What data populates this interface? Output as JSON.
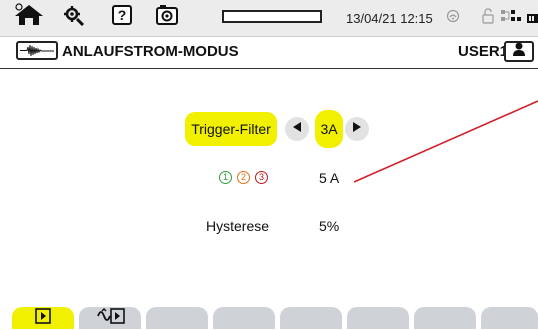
{
  "status_bar": {
    "datetime": "13/04/21 12:15",
    "icons": [
      "home-icon",
      "tools-icon",
      "help-icon",
      "camera-icon",
      "wifi-icon",
      "lock-icon",
      "network-icon",
      "battery-icon"
    ],
    "help_glyph": "?"
  },
  "title_bar": {
    "title": "ANLAUFSTROM-MODUS",
    "user": "USER1",
    "mode_icon": "waveform-icon",
    "user_icon": "user-icon"
  },
  "settings": {
    "trigger": {
      "label": "Trigger-Filter",
      "value": "3A"
    },
    "phases": {
      "labels": [
        "1",
        "2",
        "3"
      ],
      "colors": [
        "#2e9e3e",
        "#e0701a",
        "#c21c1c"
      ],
      "value": "5 A"
    },
    "hysteresis": {
      "label": "Hysterese",
      "value": "5%"
    }
  },
  "tabs": [
    {
      "icon": "play-icon",
      "active": true
    },
    {
      "icon": "trigger-play-icon",
      "active": false
    },
    {
      "icon": "",
      "active": false
    },
    {
      "icon": "",
      "active": false
    },
    {
      "icon": "",
      "active": false
    },
    {
      "icon": "",
      "active": false
    },
    {
      "icon": "",
      "active": false
    },
    {
      "icon": "",
      "active": false
    }
  ],
  "colors": {
    "accent": "#f0f000",
    "tab_inactive": "#cfd2d6",
    "status_bar": "#ececec",
    "annotation_line": "#d0202a"
  }
}
